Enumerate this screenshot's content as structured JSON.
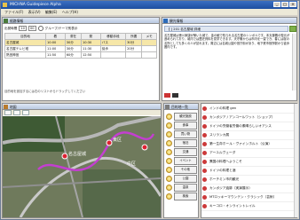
{
  "window": {
    "title": "MICHNA Guidepiece Alpha"
  },
  "menubar": [
    "ファイル(F)",
    "表示(V)",
    "編集(E)",
    "ヘルプ(H)"
  ],
  "route_panel": {
    "title": "経路情報",
    "toolbar": {
      "depart_label": "出発時間",
      "depart_time": "10",
      "depart_min": "00",
      "radio_label": "グループ/テーマ別表示"
    },
    "columns": [
      "目的地",
      "着",
      "滞在",
      "発",
      "移動手段",
      "所要",
      "メモ"
    ],
    "rows": [
      {
        "place": "名古屋城",
        "arr": "10:00",
        "stay": "30分",
        "dep": "10:30",
        "move": "バス",
        "time": "30分",
        "memo": ""
      },
      {
        "place": "名古屋テレビ塔",
        "arr": "11:00",
        "stay": "30分",
        "dep": "11:30",
        "move": "徒歩",
        "time": "20分",
        "memo": ""
      },
      {
        "place": "熱田神宮",
        "arr": "11:50",
        "stay": "60分",
        "dep": "12:50",
        "move": "",
        "time": "",
        "memo": ""
      }
    ],
    "status": "目的地を追加するには右のリストからドラッグしてください"
  },
  "info_panel": {
    "title": "観光情報",
    "heading": "【 ] 201 名古屋城 詳細",
    "body": "名古屋城は徳川家康が築いた城で、金の鯱で知られる名古屋のシンボルです。本丸御殿の復元が進められており、城内では歴史資料を見学できます。天守閣からは市内を一望でき、春には桜の名所としても多くの人が訪れます。周辺には名城公園や官庁街があり、地下鉄市役所駅から徒歩圏内です。"
  },
  "map_panel": {
    "title": "地図",
    "labels": [
      "名古屋城",
      "東区",
      "中区"
    ]
  },
  "category_panel": {
    "title": "目的地一覧",
    "buttons": [
      "観光施設",
      "食事",
      "買い物",
      "宿泊",
      "交通",
      "イベント",
      "その他",
      "公園",
      "温泉",
      "検索"
    ]
  },
  "guide_list": {
    "items": [
      "インドの料理 gen",
      "カンボジア / アンコールワット（ショップ）",
      "ドイツの労働者労働の素晴らしいオアシス",
      "スリランカ展",
      "第一生命ホール・ヴァインホルト（公演）",
      "アーユルヴェーダ",
      "異国の料理へようこそ",
      "ドイツの料理と酒",
      "ホーチミン市内観光",
      "カンボジア遺跡（実演展示）",
      "MTロッキーマウンテン・クラシック（芸術）",
      "キーコロ・オンライントレイル"
    ]
  }
}
